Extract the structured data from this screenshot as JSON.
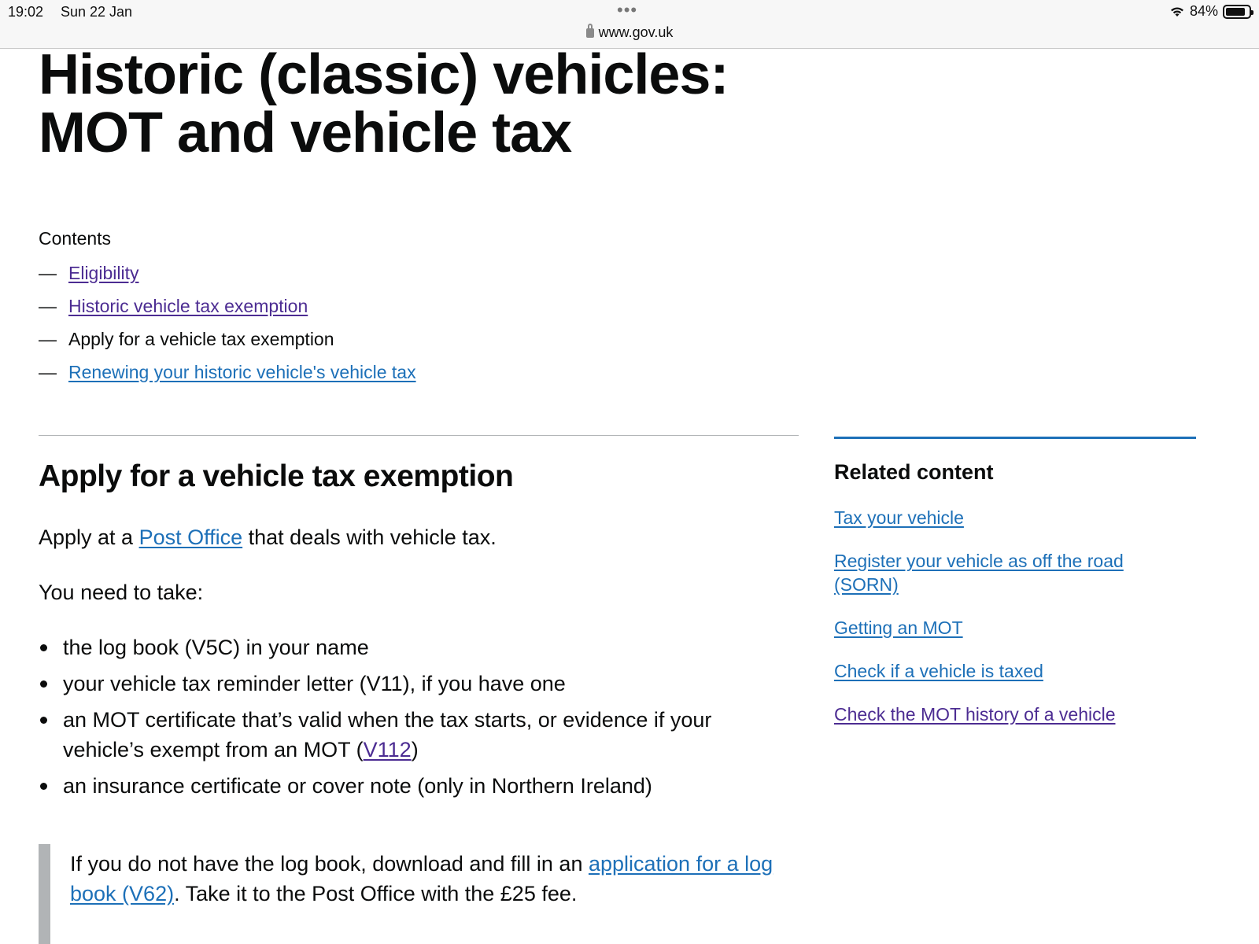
{
  "status_bar": {
    "time": "19:02",
    "date": "Sun 22 Jan",
    "dots": "•••",
    "url": "www.gov.uk",
    "battery": "84%",
    "battery_level": 0.84
  },
  "page": {
    "title": "Historic (classic) vehicles: MOT and vehicle tax",
    "contents_label": "Contents",
    "toc_dash": "—",
    "toc": [
      {
        "label": "Eligibility",
        "type": "visited"
      },
      {
        "label": "Historic vehicle tax exemption",
        "type": "visited"
      },
      {
        "label": "Apply for a vehicle tax exemption",
        "type": "current"
      },
      {
        "label": "Renewing your historic vehicle's vehicle tax",
        "type": "link"
      }
    ],
    "section_title": "Apply for a vehicle tax exemption",
    "para1": {
      "before": "Apply at a ",
      "link": "Post Office",
      "after": " that deals with vehicle tax."
    },
    "para2": "You need to take:",
    "bullets": {
      "b1": "the log book (V5C) in your name",
      "b2": "your vehicle tax reminder letter (V11), if you have one",
      "b3_before": "an MOT certificate that’s valid when the tax starts, or evidence if your vehicle’s exempt from an MOT (",
      "b3_link": "V112",
      "b3_after": ")",
      "b4": "an insurance certificate or cover note (only in Northern Ireland)"
    },
    "inset": {
      "before": "If you do not have the log book, download and fill in an ",
      "link": "application for a log book (V62)",
      "after": ". Take it to the Post Office with the £25 fee."
    }
  },
  "sidebar": {
    "title": "Related content",
    "links": [
      "Tax your vehicle",
      "Register your vehicle as off the road (SORN)",
      "Getting an MOT",
      "Check if a vehicle is taxed",
      "Check the MOT history of a vehicle"
    ]
  },
  "colors": {
    "link": "#1d70b8",
    "visited": "#4c2c92",
    "text": "#0b0c0c",
    "border": "#b1b4b6"
  }
}
